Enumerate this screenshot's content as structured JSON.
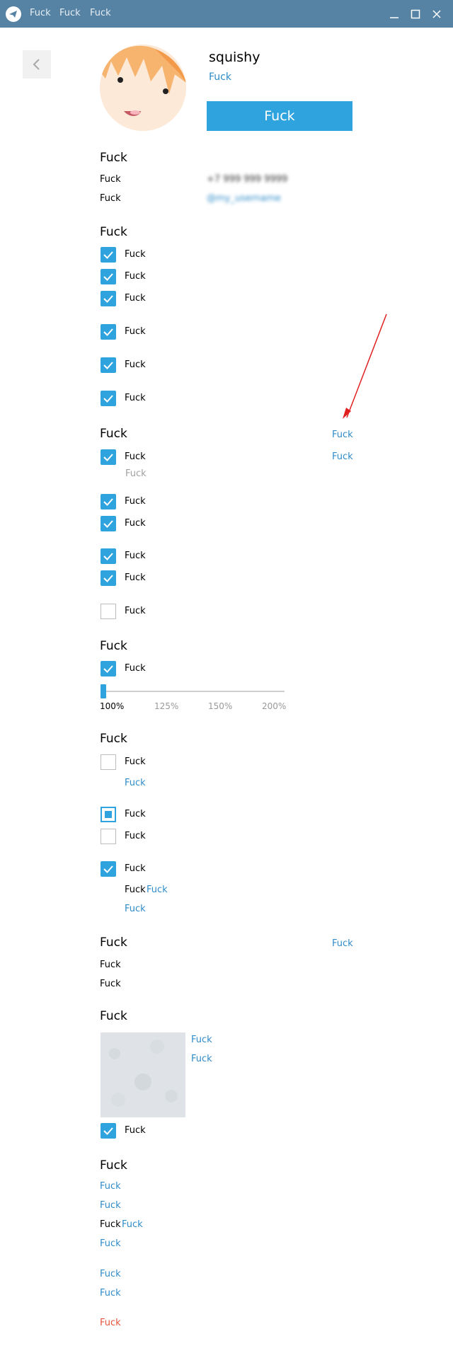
{
  "titlebar": {
    "menu": [
      "Fuck",
      "Fuck",
      "Fuck"
    ],
    "window_controls": [
      "minimize-icon",
      "maximize-icon",
      "close-icon"
    ]
  },
  "profile": {
    "name": "squishy",
    "edit_link": "Fuck",
    "main_button": "Fuck"
  },
  "info": {
    "title": "Fuck",
    "rows": [
      {
        "label": "Fuck",
        "value": "+7 999 999 9999"
      },
      {
        "label": "Fuck",
        "value": "@my_username"
      }
    ]
  },
  "notifications": {
    "title": "Fuck",
    "items": [
      {
        "label": "Fuck",
        "checked": true
      },
      {
        "label": "Fuck",
        "checked": true
      },
      {
        "label": "Fuck",
        "checked": true
      },
      {
        "label": "Fuck",
        "checked": true
      },
      {
        "label": "Fuck",
        "checked": true
      },
      {
        "label": "Fuck",
        "checked": true
      }
    ]
  },
  "general": {
    "title": "Fuck",
    "right_link_top": "Fuck",
    "right_link_second": "Fuck",
    "first_item": {
      "label": "Fuck",
      "checked": true,
      "sublabel": "Fuck"
    },
    "items": [
      {
        "label": "Fuck",
        "checked": true
      },
      {
        "label": "Fuck",
        "checked": true
      },
      {
        "label": "Fuck",
        "checked": true
      },
      {
        "label": "Fuck",
        "checked": true
      },
      {
        "label": "Fuck",
        "checked": false
      }
    ]
  },
  "scale": {
    "title": "Fuck",
    "toggle": {
      "label": "Fuck",
      "checked": true
    },
    "ticks": [
      "100%",
      "125%",
      "150%",
      "200%"
    ],
    "selected": "100%"
  },
  "chat_settings": {
    "title": "Fuck",
    "item1": {
      "label": "Fuck",
      "checked": false
    },
    "link1": "Fuck",
    "radio1": {
      "label": "Fuck",
      "selected": true
    },
    "item2": {
      "label": "Fuck",
      "checked": false
    },
    "item3": {
      "label": "Fuck",
      "checked": true
    },
    "mixed_line": {
      "text": "Fuck",
      "link": "Fuck"
    },
    "link2": "Fuck"
  },
  "background": {
    "title": "Fuck",
    "right_link": "Fuck",
    "rows": [
      "Fuck",
      "Fuck"
    ]
  },
  "wallpaper": {
    "title": "Fuck",
    "links": [
      "Fuck",
      "Fuck"
    ],
    "tile": {
      "label": "Fuck",
      "checked": true
    }
  },
  "privacy": {
    "title": "Fuck",
    "links": [
      "Fuck",
      "Fuck"
    ],
    "mixed_line": {
      "text": "Fuck",
      "link": "Fuck"
    },
    "link3": "Fuck",
    "links2": [
      "Fuck",
      "Fuck"
    ],
    "danger_link": "Fuck",
    "danger_color": "#e5533c"
  },
  "colors": {
    "titlebar": "#5682a3",
    "accent": "#2fa3dd",
    "link": "#2f8cc8",
    "annotation_arrow": "#e02020"
  }
}
